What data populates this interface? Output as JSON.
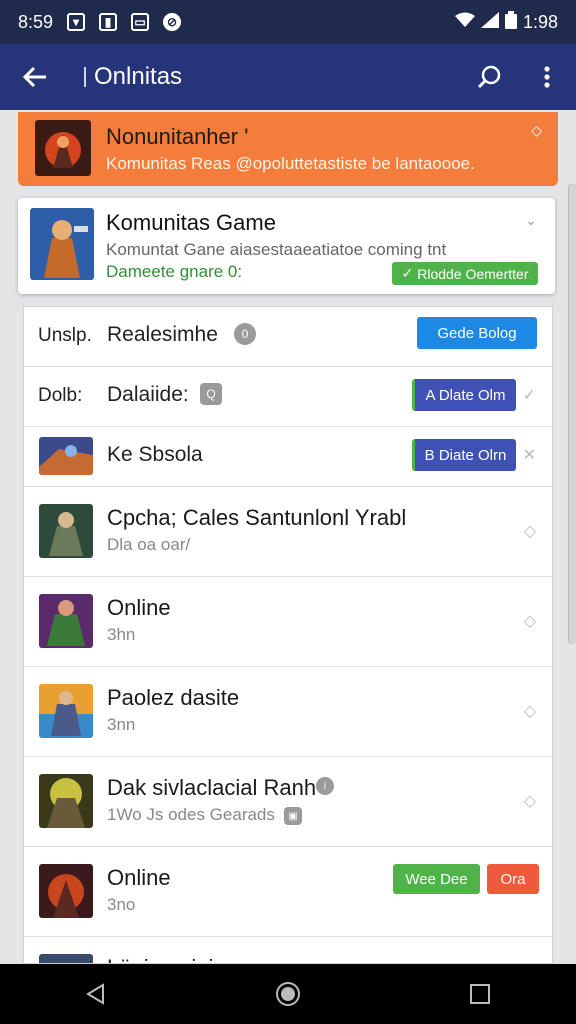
{
  "status_bar": {
    "time": "8:59",
    "battery": "1:98",
    "icons": [
      "shield-icon",
      "notes-icon",
      "message-icon",
      "blocked-icon",
      "wifi-icon",
      "signal-icon",
      "battery-icon"
    ]
  },
  "app_bar": {
    "title": "Onlnitas",
    "icons": [
      "back-arrow-icon",
      "search-icon",
      "more-vert-icon"
    ]
  },
  "banner": {
    "title": "Nonunitanher '",
    "subtitle": "Komunitas Reas @opoluttetastiste be lantaoooe.",
    "pin_icon": "diamond-icon"
  },
  "featured": {
    "title": "Komunitas Game",
    "description": "Komuntat Gane  aiasestaaeatiatoe coming tnt",
    "meta": "Dameete gnare 0:",
    "button": "Rlodde Oemertter"
  },
  "settings_rows": [
    {
      "label": "Unslp.",
      "value": "Realesimhe",
      "badge": "0",
      "button": "Gede Bolog"
    },
    {
      "label": "Dolb:",
      "value": "Dalaiide:",
      "badge": "Q",
      "button": "A Dlate Olm"
    },
    {
      "label": "",
      "value": "Ke Sbsola",
      "button": "B Diate Olrn"
    }
  ],
  "games": [
    {
      "title": "Cpcha; Cales Santunlonl Yrabl",
      "subtitle": "Dla oa oar/"
    },
    {
      "title": "Online",
      "subtitle": "3hn"
    },
    {
      "title": "Paolez dasite",
      "subtitle": "3nn"
    },
    {
      "title": "Dak sivlaclacial Ranh",
      "subtitle": "1Wo Js odes Gearads"
    },
    {
      "title": "Online",
      "subtitle": "3no",
      "buttons": [
        "Wee Dee",
        "Ora"
      ]
    },
    {
      "title": "Lägioe giaine"
    }
  ],
  "colors": {
    "statusbar": "#1f2a4d",
    "appbar": "#26347a",
    "banner": "#f47d3b",
    "green": "#4fb34a",
    "blue": "#1e88e5",
    "indigo": "#3f51b5",
    "red": "#ef5a3c"
  }
}
